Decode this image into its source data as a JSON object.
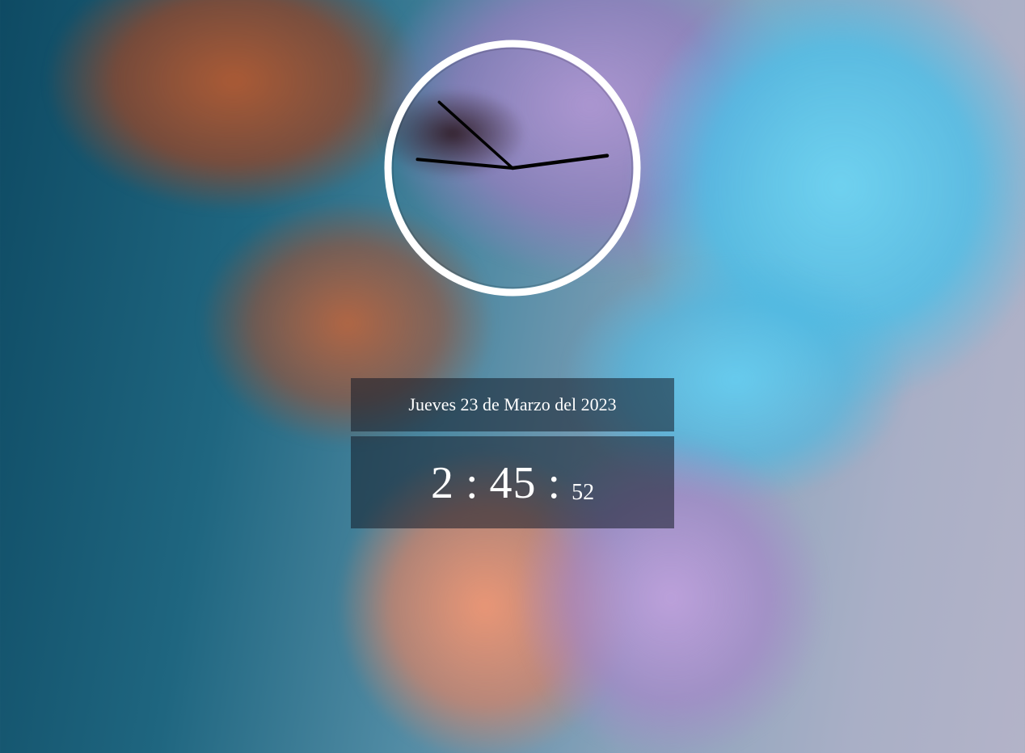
{
  "date": {
    "text": "Jueves 23 de Marzo del 2023"
  },
  "time": {
    "hours": "2",
    "minutes": "45",
    "seconds": "52",
    "separator": ":"
  },
  "analog_clock": {
    "hour": 2,
    "minute": 45,
    "second": 52,
    "hand_color": "#000000",
    "face_border_color": "#ffffff"
  },
  "colors": {
    "panel_background": "rgba(20, 28, 40, 0.55)",
    "text": "#ffffff"
  }
}
